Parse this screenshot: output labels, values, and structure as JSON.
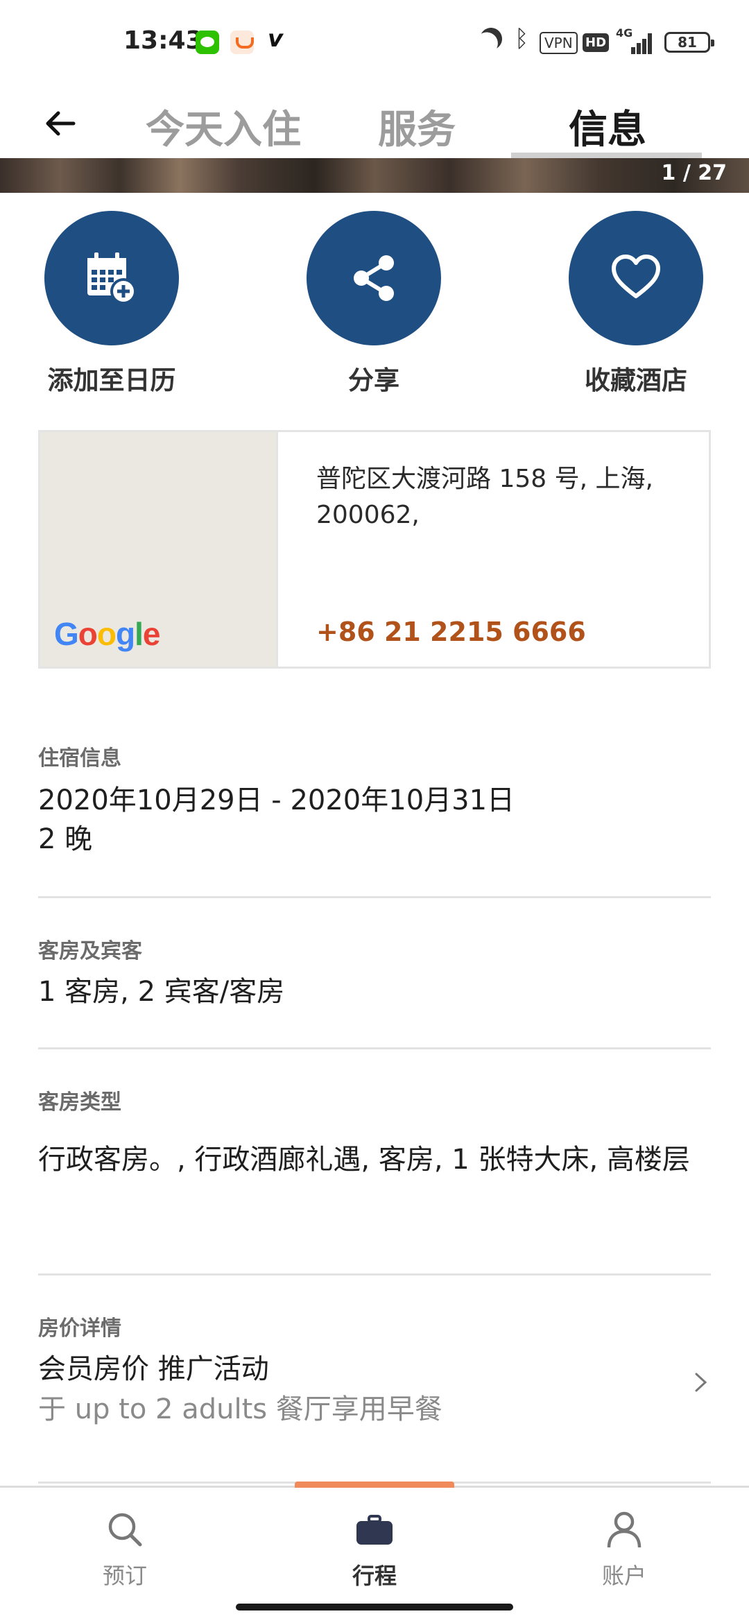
{
  "status_bar": {
    "time": "13:43",
    "vpn": "VPN",
    "hd": "HD",
    "network": "4G",
    "battery": "81",
    "icons": [
      "wechat-icon",
      "didi-icon",
      "v-app-icon",
      "moon-icon",
      "bluetooth-icon",
      "signal-icon",
      "battery-icon"
    ]
  },
  "header": {
    "back_icon": "arrow-left-icon",
    "tabs": [
      {
        "label": "今天入住",
        "active": false
      },
      {
        "label": "服务",
        "active": false
      },
      {
        "label": "信息",
        "active": true
      }
    ]
  },
  "photo": {
    "counter": "1 / 27"
  },
  "actions": [
    {
      "label": "添加至日历",
      "icon": "calendar-add-icon"
    },
    {
      "label": "分享",
      "icon": "share-icon"
    },
    {
      "label": "收藏酒店",
      "icon": "heart-icon"
    }
  ],
  "address_card": {
    "map_logo": "Google",
    "address": "普陀区大渡河路 158 号, 上海, 200062,",
    "phone": "+86 21 2215 6666"
  },
  "stay_info": {
    "label": "住宿信息",
    "dates": "2020年10月29日 - 2020年10月31日",
    "nights": "2 晚"
  },
  "rooms_guests": {
    "label": "客房及宾客",
    "value": "1 客房, 2 宾客/客房"
  },
  "room_type": {
    "label": "客房类型",
    "value": "行政客房。, 行政酒廊礼遇, 客房, 1  张特大床, 高楼层"
  },
  "rate_details": {
    "label": "房价详情",
    "value": "会员房价 推广活动",
    "subtext": "于 up to 2 adults 餐厅享用早餐"
  },
  "bottom_nav": {
    "items": [
      {
        "label": "预订",
        "icon": "search-icon",
        "active": false
      },
      {
        "label": "行程",
        "icon": "briefcase-icon",
        "active": true
      },
      {
        "label": "账户",
        "icon": "user-icon",
        "active": false
      }
    ]
  },
  "colors": {
    "accent_blue": "#1f4f82",
    "phone_orange": "#b0521a",
    "nav_indicator": "#f08a5a"
  }
}
